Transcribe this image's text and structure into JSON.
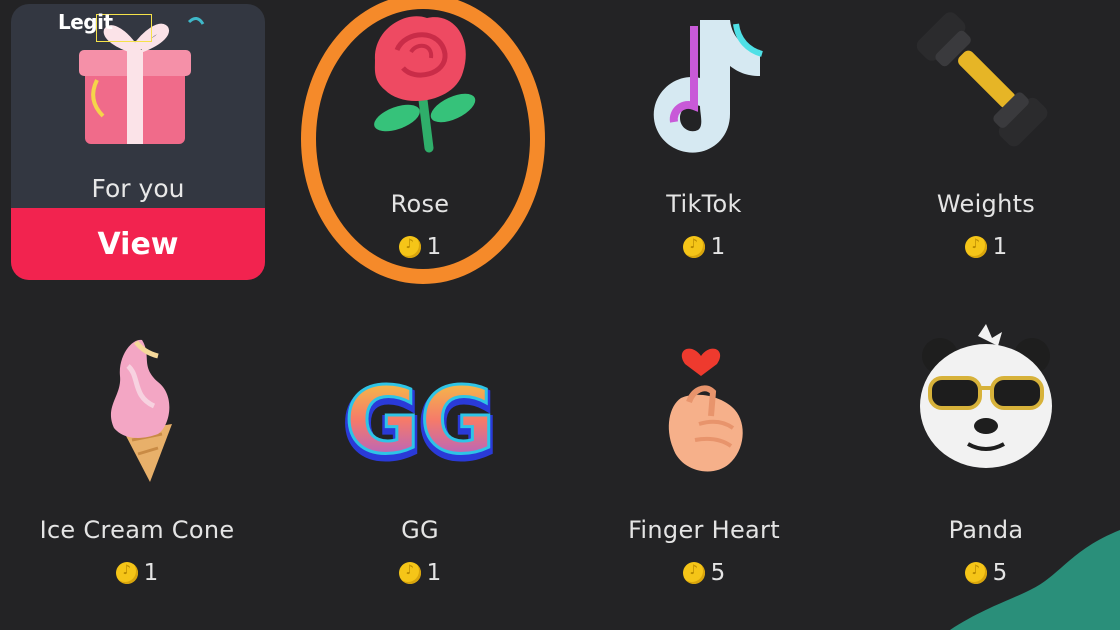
{
  "watermark": "Legit",
  "featured": {
    "label": "For you",
    "button": "View"
  },
  "gifts": [
    {
      "name": "Rose",
      "price": "1",
      "icon": "rose-icon"
    },
    {
      "name": "TikTok",
      "price": "1",
      "icon": "tiktok-logo-icon"
    },
    {
      "name": "Weights",
      "price": "1",
      "icon": "dumbbell-icon"
    },
    {
      "name": "Ice Cream Cone",
      "price": "1",
      "icon": "ice-cream-icon"
    },
    {
      "name": "GG",
      "price": "1",
      "icon": "gg-icon"
    },
    {
      "name": "Finger Heart",
      "price": "5",
      "icon": "finger-heart-icon"
    },
    {
      "name": "Panda",
      "price": "5",
      "icon": "panda-icon"
    }
  ],
  "colors": {
    "background": "#232325",
    "accent": "#f2234f",
    "highlight": "#f58a2a",
    "coin": "#f5c518"
  }
}
